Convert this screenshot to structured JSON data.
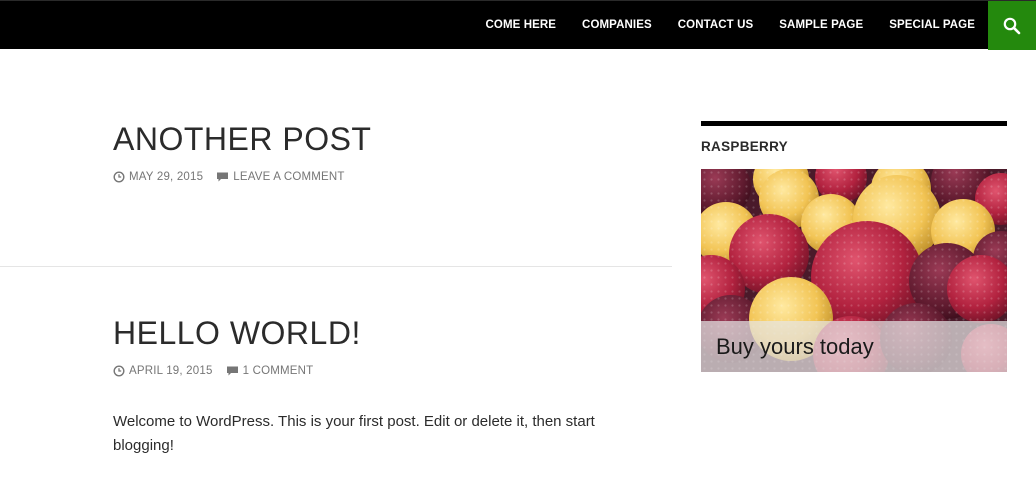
{
  "header": {
    "nav": [
      {
        "label": "COME HERE"
      },
      {
        "label": "COMPANIES"
      },
      {
        "label": "CONTACT US"
      },
      {
        "label": "SAMPLE PAGE"
      },
      {
        "label": "SPECIAL PAGE"
      }
    ],
    "search_icon": "search-icon",
    "accent_color": "#24890d"
  },
  "posts": [
    {
      "title": "ANOTHER POST",
      "date": "MAY 29, 2015",
      "comments": "LEAVE A COMMENT",
      "excerpt": ""
    },
    {
      "title": "HELLO WORLD!",
      "date": "APRIL 19, 2015",
      "comments": "1 COMMENT",
      "excerpt": "Welcome to WordPress. This is your first post. Edit or delete it, then start blogging!"
    }
  ],
  "sidebar": {
    "widget_title": "RASPBERRY",
    "image_caption": "Buy yours today",
    "image_subject": "raspberries-photo"
  }
}
